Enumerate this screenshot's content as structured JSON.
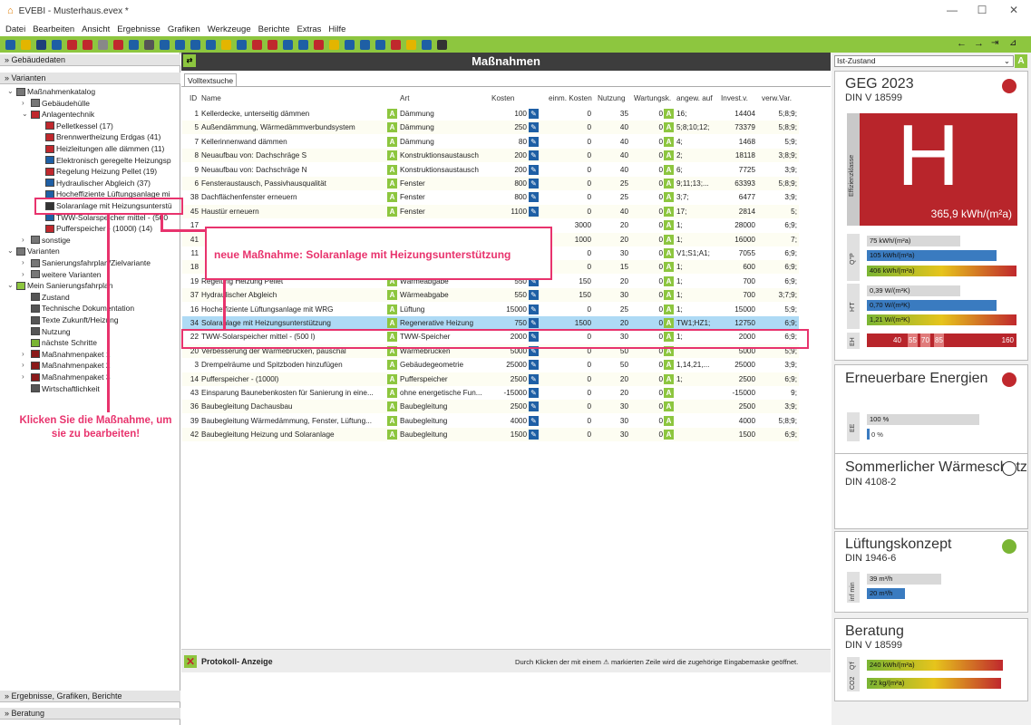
{
  "window": {
    "title": "EVEBI - Musterhaus.evex *"
  },
  "menu": [
    "Datei",
    "Bearbeiten",
    "Ansicht",
    "Ergebnisse",
    "Grafiken",
    "Werkzeuge",
    "Berichte",
    "Extras",
    "Hilfe"
  ],
  "left": {
    "gebaeudedaten": "» Gebäudedaten",
    "varianten_head": "» Varianten",
    "ergebnisse": "» Ergebnisse, Grafiken, Berichte",
    "beratung": "» Beratung"
  },
  "tree": [
    {
      "label": "Maßnahmenkatalog",
      "indent": 0,
      "caret": "v"
    },
    {
      "label": "Gebäudehülle",
      "indent": 1,
      "caret": ">"
    },
    {
      "label": "Anlagentechnik",
      "indent": 1,
      "caret": "v"
    },
    {
      "label": "Pelletkessel (17)",
      "indent": 2,
      "caret": ""
    },
    {
      "label": "Brennwertheizung Erdgas (41)",
      "indent": 2,
      "caret": ""
    },
    {
      "label": "Heizleitungen alle dämmen (11)",
      "indent": 2,
      "caret": ""
    },
    {
      "label": "Elektronisch geregelte Heizungsp",
      "indent": 2,
      "caret": ""
    },
    {
      "label": "Regelung Heizung Pellet (19)",
      "indent": 2,
      "caret": ""
    },
    {
      "label": "Hydraulischer Abgleich (37)",
      "indent": 2,
      "caret": ""
    },
    {
      "label": "Hocheffiziente Lüftungsanlage mi",
      "indent": 2,
      "caret": ""
    },
    {
      "label": "Solaranlage mit Heizungsunterstü",
      "indent": 2,
      "caret": ""
    },
    {
      "label": "TWW-Solarspeicher mittel - (500",
      "indent": 2,
      "caret": ""
    },
    {
      "label": "Pufferspeicher - (1000l) (14)",
      "indent": 2,
      "caret": ""
    },
    {
      "label": "sonstige",
      "indent": 1,
      "caret": ">"
    },
    {
      "label": "Varianten",
      "indent": 0,
      "caret": "v"
    },
    {
      "label": "Sanierungsfahrplan/Zielvariante",
      "indent": 1,
      "caret": ">"
    },
    {
      "label": "weitere Varianten",
      "indent": 1,
      "caret": ">"
    },
    {
      "label": "Mein Sanierungsfahrplan",
      "indent": 0,
      "caret": "v"
    },
    {
      "label": "Zustand",
      "indent": 1,
      "caret": ""
    },
    {
      "label": "Technische Dokumentation",
      "indent": 1,
      "caret": ""
    },
    {
      "label": "Texte Zukunft/Heizung",
      "indent": 1,
      "caret": ""
    },
    {
      "label": "Nutzung",
      "indent": 1,
      "caret": ""
    },
    {
      "label": "nächste Schritte",
      "indent": 1,
      "caret": ""
    },
    {
      "label": "Maßnahmenpaket 1",
      "indent": 1,
      "caret": ">"
    },
    {
      "label": "Maßnahmenpaket 2",
      "indent": 1,
      "caret": ">"
    },
    {
      "label": "Maßnahmenpaket 3",
      "indent": 1,
      "caret": ">"
    },
    {
      "label": "Wirtschaftlichkeit",
      "indent": 1,
      "caret": ""
    }
  ],
  "center": {
    "title": "Maßnahmen",
    "tab": "Volltextsuche",
    "headers": {
      "id": "ID",
      "name": "Name",
      "art": "Art",
      "kosten": "Kosten",
      "einm": "einm. Kosten",
      "nutzung": "Nutzung",
      "wartung": "Wartungsk.",
      "angew": "angew. auf",
      "invest": "Invest.v.",
      "verw": "verw.Var."
    },
    "rows": [
      [
        "1",
        "Kellerdecke, unterseitig dämmen",
        "Dämmung",
        "100",
        "0",
        "35",
        "0",
        "16;",
        "14404",
        "5;8;9;"
      ],
      [
        "5",
        "Außendämmung, Wärmedämmverbundsystem",
        "Dämmung",
        "250",
        "0",
        "40",
        "0",
        "5;8;10;12;",
        "73379",
        "5;8;9;"
      ],
      [
        "7",
        "Kellerinnenwand dämmen",
        "Dämmung",
        "80",
        "0",
        "40",
        "0",
        "4;",
        "1468",
        "5;9;"
      ],
      [
        "8",
        "Neuaufbau von: Dachschräge S",
        "Konstruktionsaustausch",
        "200",
        "0",
        "40",
        "0",
        "2;",
        "18118",
        "3;8;9;"
      ],
      [
        "9",
        "Neuaufbau von: Dachschräge N",
        "Konstruktionsaustausch",
        "200",
        "0",
        "40",
        "0",
        "6;",
        "7725",
        "3;9;"
      ],
      [
        "6",
        "Fensteraustausch, Passivhausqualität",
        "Fenster",
        "800",
        "0",
        "25",
        "0",
        "9;11;13;...",
        "63393",
        "5;8;9;"
      ],
      [
        "38",
        "Dachflächenfenster erneuern",
        "Fenster",
        "800",
        "0",
        "25",
        "0",
        "3;7;",
        "6477",
        "3;9;"
      ],
      [
        "45",
        "Haustür erneuern",
        "Fenster",
        "1100",
        "0",
        "40",
        "0",
        "17;",
        "2814",
        "5;"
      ],
      [
        "17",
        "",
        "",
        "",
        "3000",
        "20",
        "0",
        "1;",
        "28000",
        "6;9;"
      ],
      [
        "41",
        "",
        "",
        "",
        "1000",
        "20",
        "0",
        "1;",
        "16000",
        "7;"
      ],
      [
        "11",
        "",
        "",
        "",
        "0",
        "30",
        "0",
        "V1;S1;A1;",
        "7055",
        "6;9;"
      ],
      [
        "18",
        "",
        "",
        "",
        "0",
        "15",
        "0",
        "1;",
        "600",
        "6;9;"
      ],
      [
        "19",
        "Regelung Heizung Pellet",
        "Wärmeabgabe",
        "550",
        "150",
        "20",
        "0",
        "1;",
        "700",
        "6;9;"
      ],
      [
        "37",
        "Hydraulischer Abgleich",
        "Wärmeabgabe",
        "550",
        "150",
        "30",
        "0",
        "1;",
        "700",
        "3;7;9;"
      ],
      [
        "16",
        "Hocheffiziente Lüftungsanlage mit WRG",
        "Lüftung",
        "15000",
        "0",
        "25",
        "0",
        "1;",
        "15000",
        "5;9;"
      ],
      [
        "34",
        "Solaranlage mit Heizungsunterstützung",
        "Regenerative Heizung",
        "750",
        "1500",
        "20",
        "0",
        "TW1;HZ1;",
        "12750",
        "6;9;"
      ],
      [
        "22",
        "TWW-Solarspeicher mittel - (500 l)",
        "TWW-Speicher",
        "2000",
        "0",
        "30",
        "0",
        "1;",
        "2000",
        "6;9;"
      ],
      [
        "20",
        "Verbesserung der Wärmebrücken, pauschal",
        "Wärmebrücken",
        "5000",
        "0",
        "50",
        "0",
        "",
        "5000",
        "5;9;"
      ],
      [
        "3",
        "Drempelräume und Spitzboden hinzufügen",
        "Gebäudegeometrie",
        "25000",
        "0",
        "50",
        "0",
        "1,14,21,...",
        "25000",
        "3;9;"
      ],
      [
        "14",
        "Pufferspeicher - (1000l)",
        "Pufferspeicher",
        "2500",
        "0",
        "20",
        "0",
        "1;",
        "2500",
        "6;9;"
      ],
      [
        "43",
        "Einsparung Baunebenkosten für Sanierung in eine...",
        "ohne energetische Fun...",
        "-15000",
        "0",
        "20",
        "0",
        "",
        "-15000",
        "9;"
      ],
      [
        "36",
        "Baubegleitung Dachausbau",
        "Baubegleitung",
        "2500",
        "0",
        "30",
        "0",
        "",
        "2500",
        "3;9;"
      ],
      [
        "39",
        "Baubegleitung Wärmedämmung, Fenster, Lüftung...",
        "Baubegleitung",
        "4000",
        "0",
        "30",
        "0",
        "",
        "4000",
        "5;8;9;"
      ],
      [
        "42",
        "Baubegleitung Heizung und Solaranlage",
        "Baubegleitung",
        "1500",
        "0",
        "30",
        "0",
        "",
        "1500",
        "6;9;"
      ]
    ],
    "callout": "neue Maßnahme: Solaranlage mit Heizungsunterstützung",
    "callout2": "Klicken Sie die Maßnahme, um sie zu bearbeiten!",
    "protokoll": "Protokoll- Anzeige",
    "hint": "Durch Klicken der mit einem ⚠ markierten Zeile wird die zugehörige Eingabemaske geöffnet."
  },
  "right": {
    "dropdown": "Ist-Zustand",
    "badge": "A",
    "geg": {
      "title": "GEG 2023",
      "sub": "DIN V 18599",
      "klasse": "H",
      "klasse_label": "Effizienzklasse",
      "value": "365,9 kWh/(m²a)",
      "q_label": "Q''P",
      "q1": "75 kWh/(m²a)",
      "q2": "105 kWh/(m²a)",
      "q3": "406 kWh/(m²a)",
      "h_label": "H'T",
      "h1": "0,39 W/(m²K)",
      "h2": "0,70 W/(m²K)",
      "h3": "1,21 W/(m²K)",
      "eh_label": "EH",
      "eh": [
        "40",
        "55",
        "70",
        "85",
        "160"
      ],
      "dot": "#c0282d"
    },
    "ee": {
      "title": "Erneuerbare Energien",
      "label": "EE",
      "v1": "100 %",
      "v2": "0 %",
      "dot": "#c0282d"
    },
    "sw": {
      "title": "Sommerlicher Wärmeschutz",
      "sub": "DIN 4108-2"
    },
    "lk": {
      "title": "Lüftungskonzept",
      "sub": "DIN 1946-6",
      "label": "inf min",
      "v1": "39 m³/h",
      "v2": "20 m³/h",
      "dot": "#7ab534"
    },
    "ber": {
      "title": "Beratung",
      "sub": "DIN V 18599",
      "label1": "Q'f",
      "label2": "CO2",
      "v1": "240 kWh/(m²a)",
      "v2": "72 kg/(m²a)"
    }
  }
}
